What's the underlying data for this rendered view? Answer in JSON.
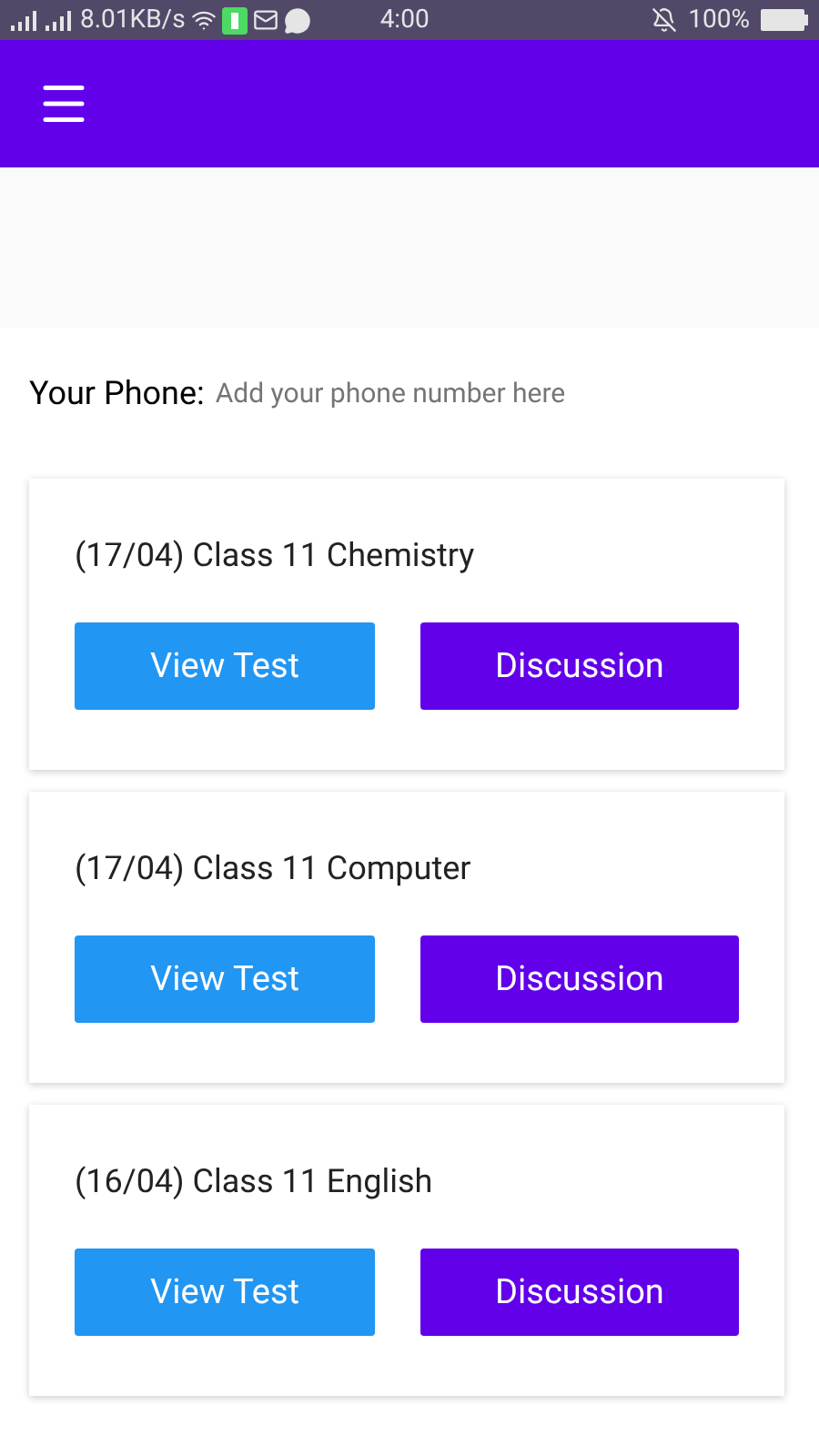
{
  "status_bar": {
    "speed": "8.01KB/s",
    "time": "4:00",
    "battery": "100%"
  },
  "phone": {
    "label": "Your Phone:",
    "placeholder": "Add your phone number here"
  },
  "tests": [
    {
      "title": "(17/04) Class 11 Chemistry",
      "buttons": [
        "View Test",
        "Discussion"
      ]
    },
    {
      "title": "(17/04) Class 11 Computer",
      "buttons": [
        "View Test",
        "Discussion"
      ]
    },
    {
      "title": "(16/04) Class 11 English",
      "buttons": [
        "View Test",
        "Discussion"
      ]
    }
  ]
}
